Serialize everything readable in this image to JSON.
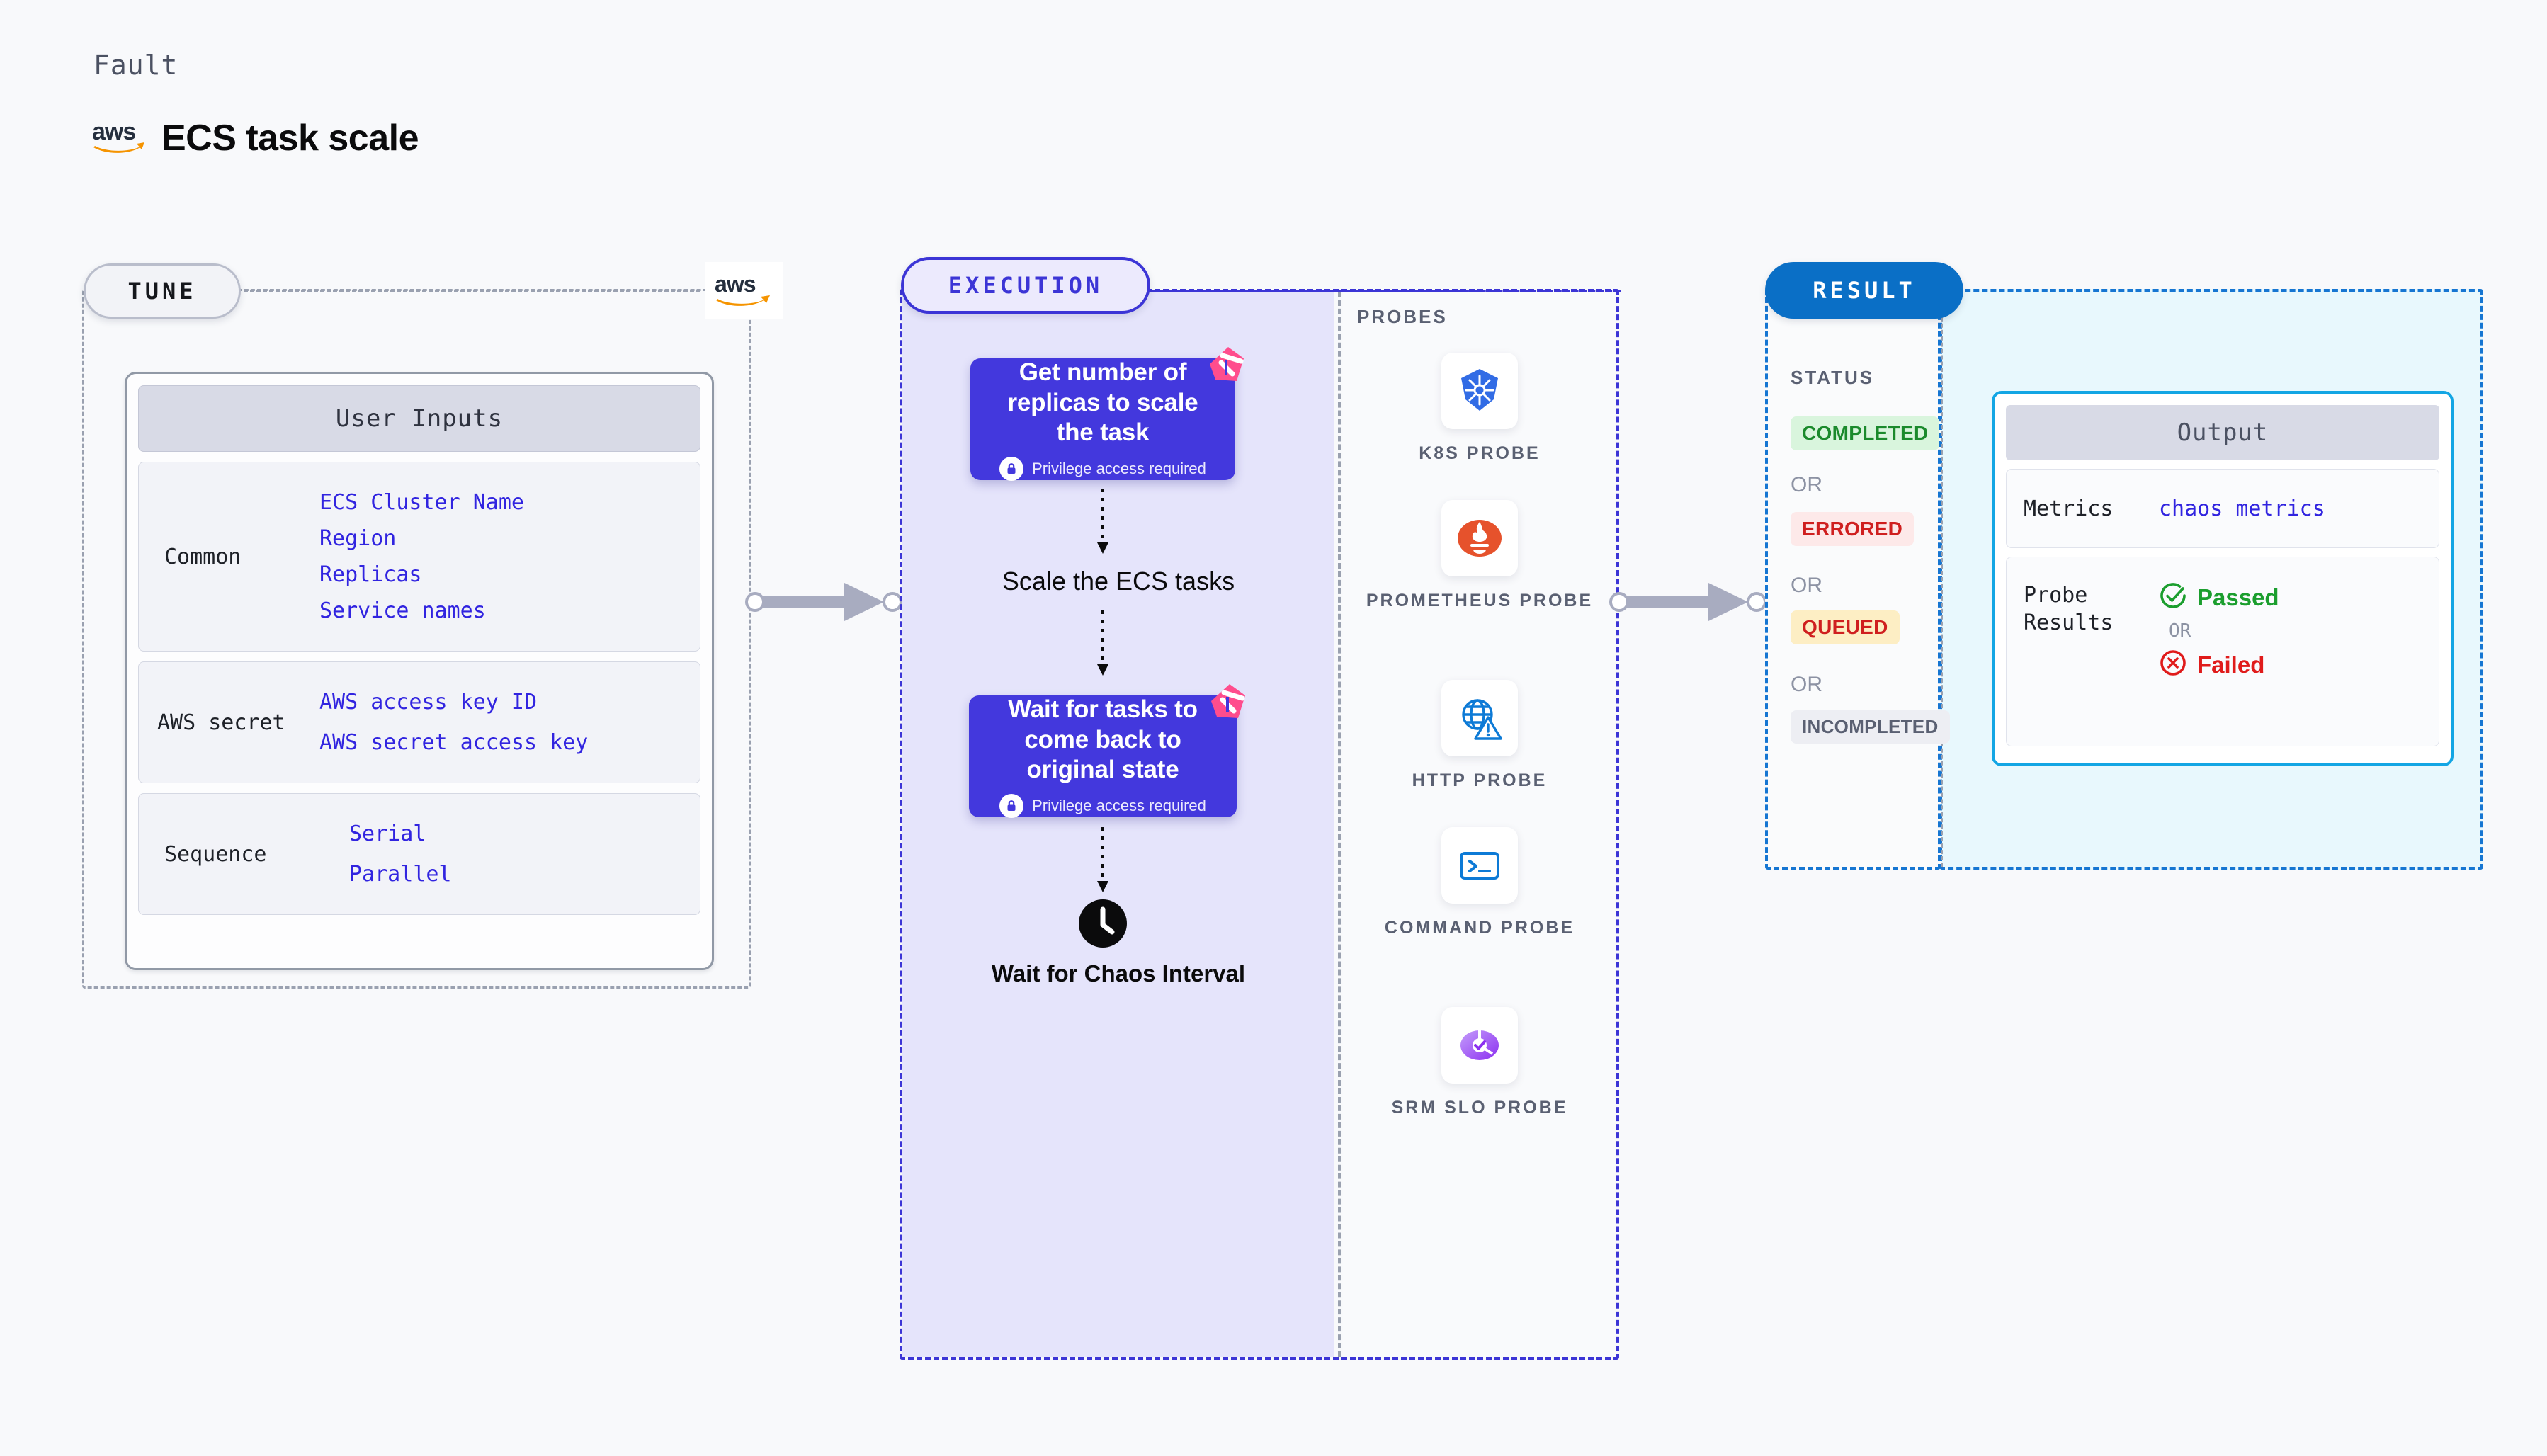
{
  "header": {
    "kicker": "Fault",
    "title": "ECS task scale",
    "brand_icon": "aws-logo"
  },
  "tune": {
    "pill_label": "TUNE",
    "brand_icon": "aws-logo",
    "card_title": "User Inputs",
    "groups": [
      {
        "label": "Common",
        "values": [
          "ECS Cluster Name",
          "Region",
          "Replicas",
          "Service names"
        ]
      },
      {
        "label": "AWS secret",
        "values": [
          "AWS access key ID",
          "AWS secret access key"
        ]
      },
      {
        "label": "Sequence",
        "values": [
          "Serial",
          "Parallel"
        ]
      }
    ]
  },
  "execution": {
    "pill_label": "EXECUTION",
    "steps": [
      {
        "type": "box",
        "text": "Get number of replicas to scale the task",
        "note": "Privilege access required",
        "note_icon": "lock-icon",
        "badge_icon": "harness-logo-icon"
      },
      {
        "type": "text",
        "text": "Scale the ECS tasks"
      },
      {
        "type": "box",
        "text": "Wait for tasks to come back to original state",
        "note": "Privilege access required",
        "note_icon": "lock-icon",
        "badge_icon": "harness-logo-icon"
      },
      {
        "type": "clock",
        "icon": "clock-icon",
        "text": "Wait for Chaos Interval"
      }
    ]
  },
  "probes": {
    "title": "PROBES",
    "items": [
      {
        "label": "K8S PROBE",
        "icon": "kubernetes-icon"
      },
      {
        "label": "PROMETHEUS PROBE",
        "icon": "prometheus-icon"
      },
      {
        "label": "HTTP PROBE",
        "icon": "http-globe-warning-icon"
      },
      {
        "label": "COMMAND PROBE",
        "icon": "terminal-icon"
      },
      {
        "label": "SRM SLO PROBE",
        "icon": "srm-slo-icon"
      }
    ]
  },
  "result": {
    "pill_label": "RESULT",
    "status_title": "STATUS",
    "or_label": "OR",
    "statuses": [
      {
        "label": "COMPLETED",
        "bg": "#d9f5dd",
        "fg": "#1b8a2c"
      },
      {
        "label": "ERRORED",
        "bg": "#fde9e9",
        "fg": "#cf1f1f"
      },
      {
        "label": "QUEUED",
        "bg": "#fdeec4",
        "fg": "#cf1f1f"
      },
      {
        "label": "INCOMPLETED",
        "bg": "#edeef3",
        "fg": "#5a6072"
      }
    ],
    "output": {
      "title": "Output",
      "metrics_label": "Metrics",
      "metrics_value": "chaos metrics",
      "probe_results_label": "Probe Results",
      "or_label": "OR",
      "passed_label": "Passed",
      "passed_icon": "check-circle-icon",
      "passed_color": "#1b9e2e",
      "failed_label": "Failed",
      "failed_icon": "x-circle-icon",
      "failed_color": "#e01b1b"
    }
  },
  "colors": {
    "execution_accent": "#3c35d6",
    "execution_fill": "#e5e4fb",
    "result_accent": "#1676d2",
    "output_accent": "#13a6e4",
    "tune_accent": "#9aa1b0",
    "input_value": "#3124e0",
    "aws_orange": "#f59400"
  }
}
